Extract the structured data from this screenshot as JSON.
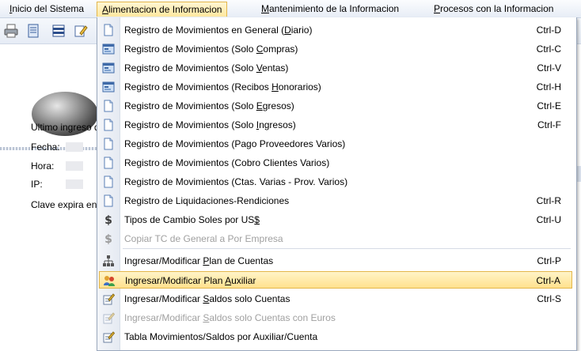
{
  "menubar": {
    "items": [
      {
        "pre": "",
        "key": "I",
        "post": "nicio del Sistema"
      },
      {
        "pre": "",
        "key": "A",
        "post": "limentacion de Informacion"
      },
      {
        "pre": "",
        "key": "M",
        "post": "antenimiento de la Informacion"
      },
      {
        "pre": "",
        "key": "P",
        "post": "rocesos con la Informacion"
      }
    ]
  },
  "toolbar": {
    "icons": [
      "printer-icon",
      "document-icon",
      "list-icon",
      "edit-icon"
    ]
  },
  "login_info": {
    "last_login_label": "Ultimo ingreso de",
    "date_label": "Fecha:",
    "time_label": "Hora:",
    "ip_label": "IP:",
    "password_expires_label": "Clave expira en:"
  },
  "menu": {
    "items": [
      {
        "pre": "Registro de Movimientos en General (",
        "key": "D",
        "post": "iario)",
        "shortcut": "Ctrl-D",
        "icon": "document-icon",
        "enabled": true
      },
      {
        "pre": "Registro de Movimientos (Solo ",
        "key": "C",
        "post": "ompras)",
        "shortcut": "Ctrl-C",
        "icon": "window-icon",
        "enabled": true
      },
      {
        "pre": "Registro de Movimientos (Solo ",
        "key": "V",
        "post": "entas)",
        "shortcut": "Ctrl-V",
        "icon": "window-icon",
        "enabled": true
      },
      {
        "pre": "Registro de Movimientos (Recibos ",
        "key": "H",
        "post": "onorarios)",
        "shortcut": "Ctrl-H",
        "icon": "window-icon",
        "enabled": true
      },
      {
        "pre": "Registro de Movimientos (Solo ",
        "key": "E",
        "post": "gresos)",
        "shortcut": "Ctrl-E",
        "icon": "document-icon",
        "enabled": true
      },
      {
        "pre": "Registro de Movimientos (Solo ",
        "key": "I",
        "post": "ngresos)",
        "shortcut": "Ctrl-F",
        "icon": "document-icon",
        "enabled": true
      },
      {
        "pre": "Registro de Movimientos (Pago Proveedores Varios)",
        "key": "",
        "post": "",
        "shortcut": "",
        "icon": "document-icon",
        "enabled": true
      },
      {
        "pre": "Registro de Movimientos (Cobro Clientes Varios)",
        "key": "",
        "post": "",
        "shortcut": "",
        "icon": "document-icon",
        "enabled": true
      },
      {
        "pre": "Registro de Movimientos (Ctas. Varias - Prov. Varios)",
        "key": "",
        "post": "",
        "shortcut": "",
        "icon": "document-icon",
        "enabled": true
      },
      {
        "pre": "Registro de Liquidaciones-Rendiciones",
        "key": "",
        "post": "",
        "shortcut": "Ctrl-R",
        "icon": "document-icon",
        "enabled": true
      },
      {
        "pre": "Tipos de Cambio Soles por US",
        "key": "$",
        "post": "",
        "shortcut": "Ctrl-U",
        "icon": "dollar-icon",
        "enabled": true
      },
      {
        "pre": "Copiar TC de General a Por Empresa",
        "key": "",
        "post": "",
        "shortcut": "",
        "icon": "dollar-icon",
        "enabled": false
      },
      {
        "pre": "Ingresar/Modificar ",
        "key": "P",
        "post": "lan de Cuentas",
        "shortcut": "Ctrl-P",
        "icon": "hierarchy-icon",
        "enabled": true
      },
      {
        "pre": "Ingresar/Modificar Plan ",
        "key": "A",
        "post": "uxiliar",
        "shortcut": "Ctrl-A",
        "icon": "users-icon",
        "enabled": true,
        "selected": true
      },
      {
        "pre": "Ingresar/Modificar ",
        "key": "S",
        "post": "aldos solo Cuentas",
        "shortcut": "Ctrl-S",
        "icon": "pencil-doc-icon",
        "enabled": true
      },
      {
        "pre": "Ingresar/Modificar ",
        "key": "S",
        "post": "aldos solo Cuentas con Euros",
        "shortcut": "",
        "icon": "pencil-doc-icon",
        "enabled": false
      },
      {
        "pre": "Tabla Movimientos/Saldos por Auxiliar/Cuenta",
        "key": "",
        "post": "",
        "shortcut": "",
        "icon": "pencil-doc-icon",
        "enabled": true
      }
    ]
  },
  "colors": {
    "highlight": "#ffe18e",
    "highlight_border": "#e3b64a",
    "disabled_text": "#a0a0a0",
    "dollar_green": "#2f7d32"
  }
}
